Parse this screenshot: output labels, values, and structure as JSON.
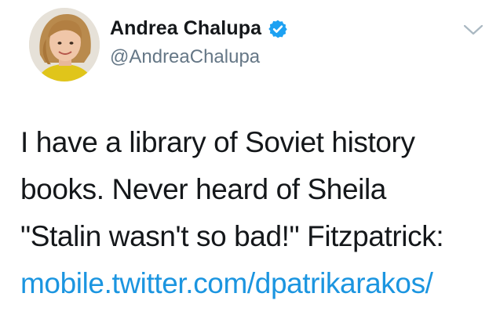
{
  "author": {
    "display_name": "Andrea Chalupa",
    "handle": "@AndreaChalupa",
    "verified": true
  },
  "icons": {
    "verified": "verified-badge-icon",
    "menu": "chevron-down-icon"
  },
  "tweet": {
    "lines": [
      "I have a library of Soviet history",
      "books. Never heard of Sheila",
      "\"Stalin wasn't so bad!\" Fitzpatrick:"
    ],
    "link": "mobile.twitter.com/dpatrikarakos/"
  },
  "colors": {
    "link": "#1b95e0",
    "verified": "#1da1f2",
    "handle": "#657786",
    "text": "#14171a"
  }
}
